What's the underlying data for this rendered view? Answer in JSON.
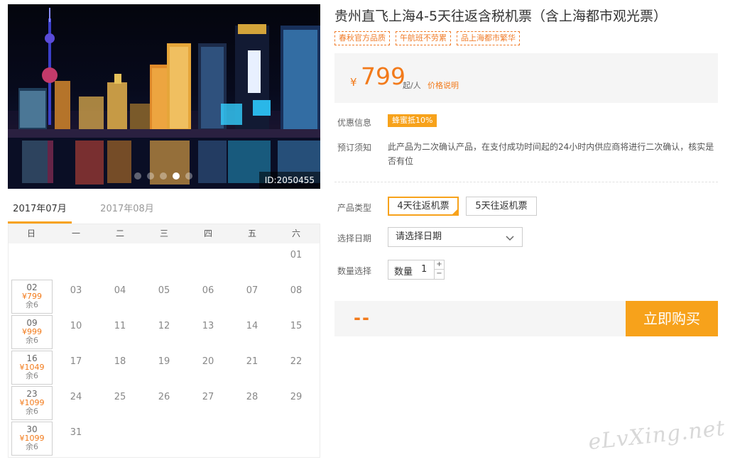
{
  "product": {
    "title": "贵州直飞上海4-5天往返含税机票（含上海都市观光票）",
    "tags": [
      "春秋官方品质",
      "午航班不劳累",
      "品上海都市繁华"
    ],
    "photo_id": "ID:2050455",
    "carousel": {
      "total": 5,
      "active": 4
    }
  },
  "price": {
    "currency": "¥",
    "amount": "799",
    "unit": "起/人",
    "link": "价格说明"
  },
  "info": {
    "promo_label": "优惠信息",
    "promo_badge": "蜂蜜抵10%",
    "booking_label": "预订须知",
    "booking_text": "此产品为二次确认产品，在支付成功时间起的24小时内供应商将进行二次确认，核实是否有位"
  },
  "options": {
    "type_label": "产品类型",
    "types": [
      "4天往返机票",
      "5天往返机票"
    ],
    "selected_type": 0,
    "date_label": "选择日期",
    "date_placeholder": "请选择日期",
    "qty_label": "数量选择",
    "qty_inner_label": "数量",
    "qty_value": "1",
    "qty_up": "+",
    "qty_down": "−"
  },
  "buy": {
    "total": "--",
    "button": "立即购买"
  },
  "calendar": {
    "tabs": [
      "2017年07月",
      "2017年08月"
    ],
    "active_tab": 0,
    "weekdays": [
      "日",
      "一",
      "二",
      "三",
      "四",
      "五",
      "六"
    ],
    "first_weekday": 6,
    "days_in_month": 31,
    "available": [
      {
        "day": "02",
        "price": "¥799",
        "left": "余6"
      },
      {
        "day": "09",
        "price": "¥999",
        "left": "余6"
      },
      {
        "day": "16",
        "price": "¥1049",
        "left": "余6"
      },
      {
        "day": "23",
        "price": "¥1099",
        "left": "余6"
      },
      {
        "day": "30",
        "price": "¥1099",
        "left": "余6"
      }
    ]
  },
  "watermark": "eLvXing.net"
}
